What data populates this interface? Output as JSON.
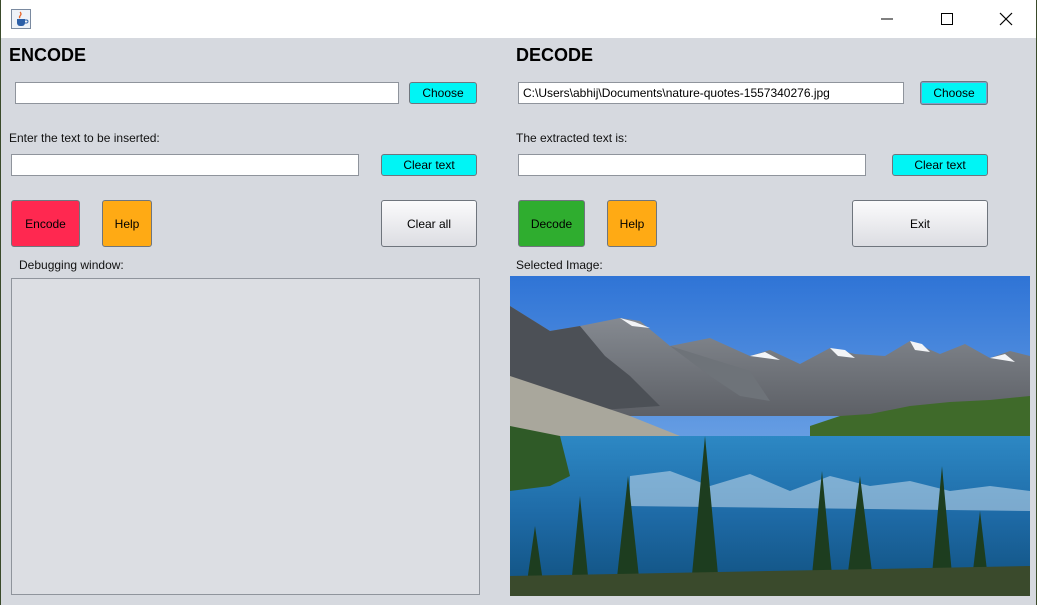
{
  "titlebar": {
    "title": "",
    "icon": "java-cup-icon"
  },
  "encode": {
    "heading": "ENCODE",
    "file_path": "",
    "choose_label": "Choose",
    "text_label": "Enter the text to be inserted:",
    "text_value": "",
    "clear_text_label": "Clear text",
    "encode_label": "Encode",
    "help_label": "Help",
    "clear_all_label": "Clear all",
    "debug_label": "Debugging window:"
  },
  "decode": {
    "heading": "DECODE",
    "file_path": "C:\\Users\\abhij\\Documents\\nature-quotes-1557340276.jpg",
    "choose_label": "Choose",
    "text_label": "The extracted text is:",
    "text_value": "",
    "clear_text_label": "Clear text",
    "decode_label": "Decode",
    "help_label": "Help",
    "exit_label": "Exit",
    "image_label": "Selected Image:"
  },
  "colors": {
    "cyan_button": "#00f5f5",
    "encode_button": "#ff2850",
    "help_button": "#ffaa14",
    "decode_button": "#2fad2f",
    "window_bg": "#d6d9df"
  }
}
